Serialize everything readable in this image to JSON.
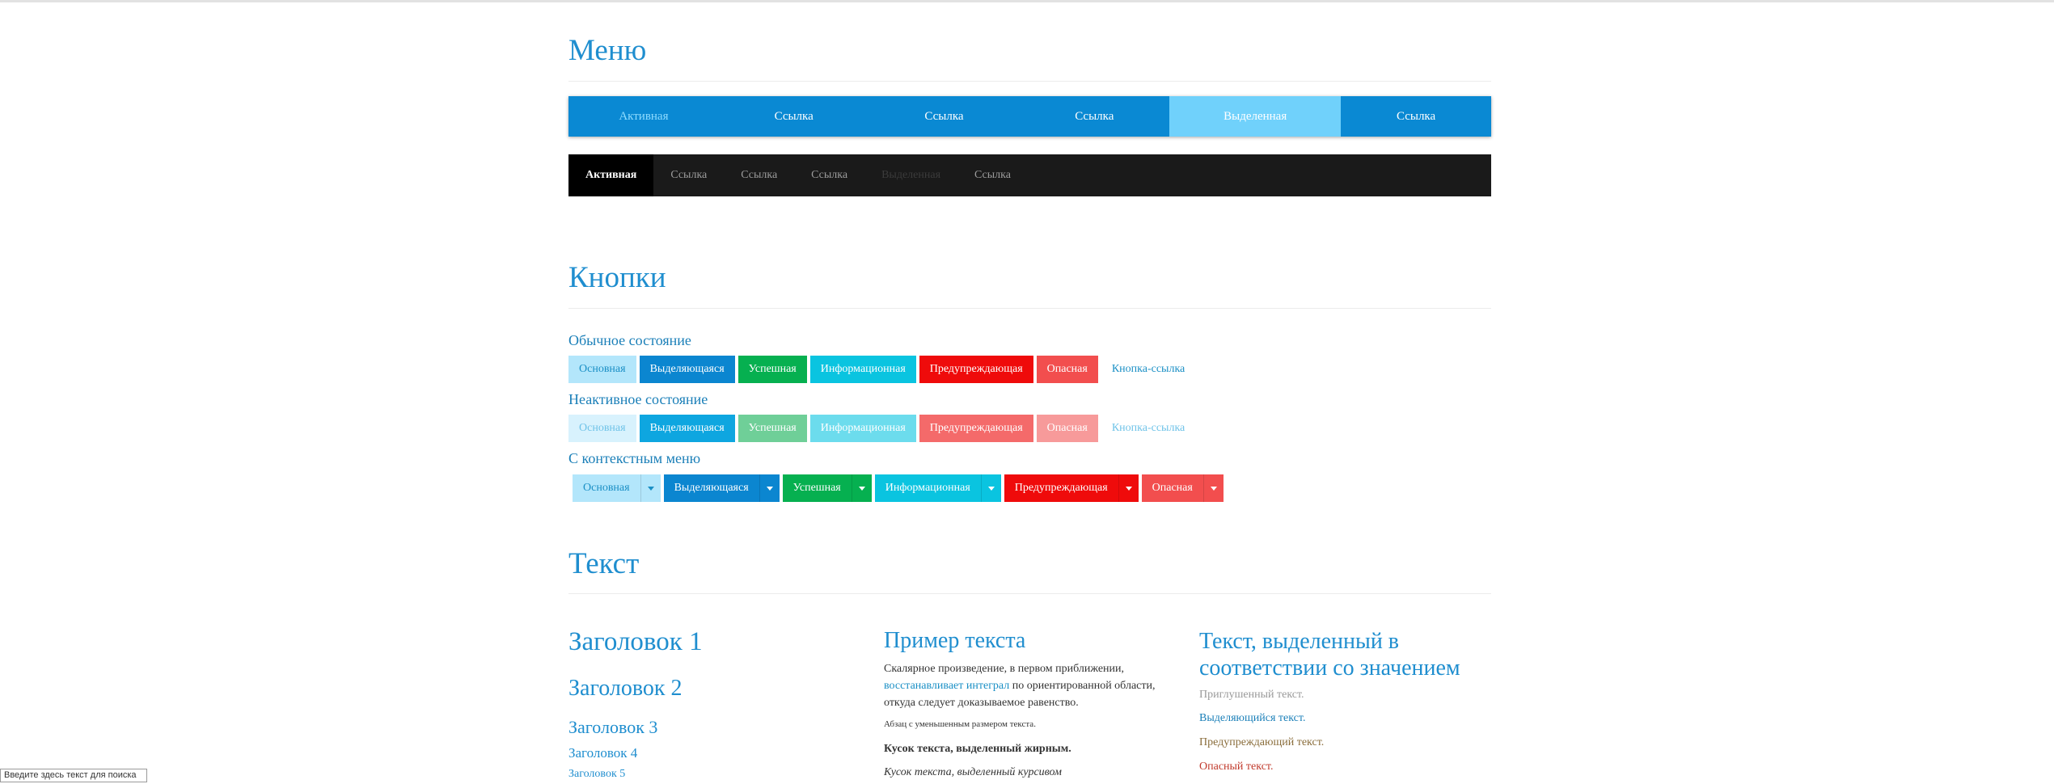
{
  "menu": {
    "title": "Меню",
    "blue_items": [
      "Активная",
      "Ссылка",
      "Ссылка",
      "Ссылка",
      "Выделенная",
      "Ссылка"
    ],
    "dark_items": [
      "Активная",
      "Ссылка",
      "Ссылка",
      "Ссылка",
      "Выделенная",
      "Ссылка"
    ]
  },
  "buttons": {
    "title": "Кнопки",
    "normal_label": "Обычное состояние",
    "disabled_label": "Неактивное состояние",
    "context_label": "С контекстным меню",
    "labels": {
      "primary": "Основная",
      "accent": "Выделяющаяся",
      "success": "Успешная",
      "info": "Информационная",
      "warning": "Предупреждающая",
      "danger": "Опасная",
      "link": "Кнопка-ссылка"
    }
  },
  "text": {
    "title": "Текст",
    "headings": [
      "Заголовок 1",
      "Заголовок 2",
      "Заголовок 3",
      "Заголовок 4",
      "Заголовок 5"
    ],
    "sample": {
      "title": "Пример текста",
      "para_before": "Скалярное произведение, в первом приближении,",
      "para_link": "восстанавливает интеграл",
      "para_after": "по ориентированной области, откуда следует доказываемое равенство.",
      "small": "Абзац с уменьшенным размером текста.",
      "bold": "Кусок текста, выделенный жирным.",
      "italic": "Кусок текста, выделенный курсивом"
    },
    "contextual": {
      "title": "Текст, выделенный в соответствии со значением",
      "muted": "Приглушенный текст.",
      "primary": "Выделяющийся текст.",
      "warning": "Предупреждающий текст.",
      "danger": "Опасный текст."
    }
  },
  "search": {
    "placeholder": "Введите здесь текст для поиска"
  },
  "colors": {
    "heading": "#1f8ecf",
    "menu_blue": "#0a89d3",
    "menu_selected": "#70d1fb",
    "menu_dark": "#1a1a1a",
    "muted": "#999999",
    "primary_text": "#1a7fb8",
    "warning_text": "#8a6d3b",
    "danger_text": "#c0392b"
  }
}
